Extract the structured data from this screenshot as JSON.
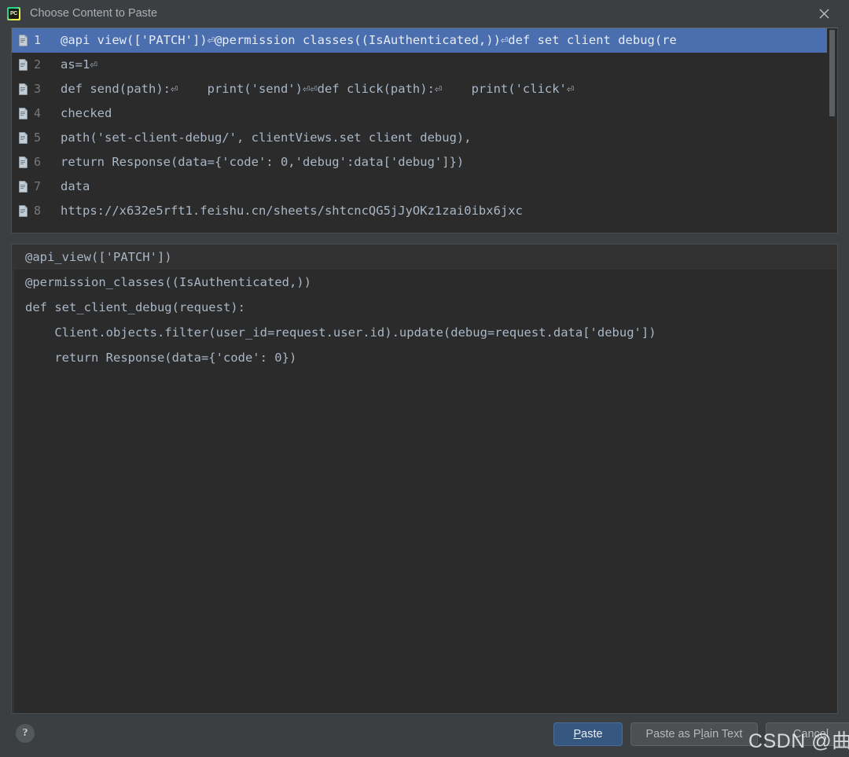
{
  "window": {
    "title": "Choose Content to Paste",
    "app_icon": "pycharm-icon",
    "app_icon_label": "PC",
    "close_icon": "close-icon"
  },
  "colors": {
    "dialog_bg": "#3c3f41",
    "list_bg": "#2b2b2b",
    "selection_bg": "#4b6eaf",
    "code_fg": "#a9b7c6",
    "primary_button_bg": "#365880",
    "button_bg": "#4c5052"
  },
  "clipboard_list": {
    "item_icon": "clipboard-document-icon",
    "selected_index": 1,
    "items": [
      {
        "index": "1",
        "text": "@api_view(['PATCH'])⏎@permission_classes((IsAuthenticated,))⏎def set_client_debug(re"
      },
      {
        "index": "2",
        "text": "as=1⏎"
      },
      {
        "index": "3",
        "text": "def send(path):⏎    print('send')⏎⏎def click(path):⏎    print('click'⏎"
      },
      {
        "index": "4",
        "text": "checked"
      },
      {
        "index": "5",
        "text": "path('set-client-debug/', clientViews.set_client_debug),"
      },
      {
        "index": "6",
        "text": "return Response(data={'code': 0,'debug':data['debug']})"
      },
      {
        "index": "7",
        "text": "data"
      },
      {
        "index": "8",
        "text": "https://x632e5rft1.feishu.cn/sheets/shtcncQG5jJyOKz1zai0ibx6jxc"
      }
    ],
    "scrollbar": "vertical-scrollbar"
  },
  "preview": {
    "lines": [
      "@api_view(['PATCH'])",
      "@permission_classes((IsAuthenticated,))",
      "def set_client_debug(request):",
      "    Client.objects.filter(user_id=request.user.id).update(debug=request.data['debug'])",
      "    return Response(data={'code': 0})"
    ],
    "current_line_index": 0
  },
  "footer": {
    "help_label": "?",
    "buttons": {
      "paste": {
        "before": "P",
        "mnemonic": "",
        "after": "aste",
        "label": "Paste"
      },
      "paste_plain": {
        "label": "Paste as Plain Text",
        "pre": "Paste as P",
        "mnemonic": "l",
        "post": "ain Text"
      },
      "cancel": {
        "label": "Cancel"
      }
    }
  },
  "watermark": {
    "text": "CSDN @曲鸟"
  }
}
